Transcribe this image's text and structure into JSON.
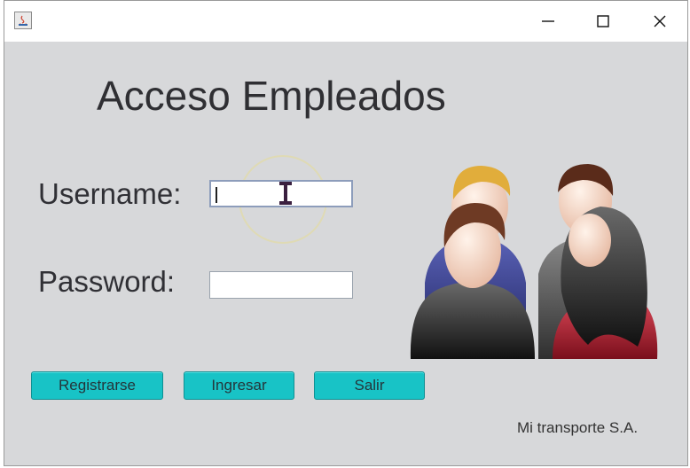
{
  "window": {
    "icon": "java-icon",
    "controls": [
      "minimize-icon",
      "maximize-icon",
      "close-icon"
    ]
  },
  "form": {
    "title": "Acceso Empleados",
    "username_label": "Username:",
    "username_value": "",
    "password_label": "Password:",
    "password_value": ""
  },
  "buttons": {
    "register": "Registrarse",
    "login": "Ingresar",
    "exit": "Salir"
  },
  "footer": {
    "company": "Mi transporte S.A."
  },
  "illustration": {
    "icon": "employees-group-icon"
  },
  "colors": {
    "button": "#18c3c6",
    "background": "#d7d8da",
    "text": "#2f2f33"
  }
}
